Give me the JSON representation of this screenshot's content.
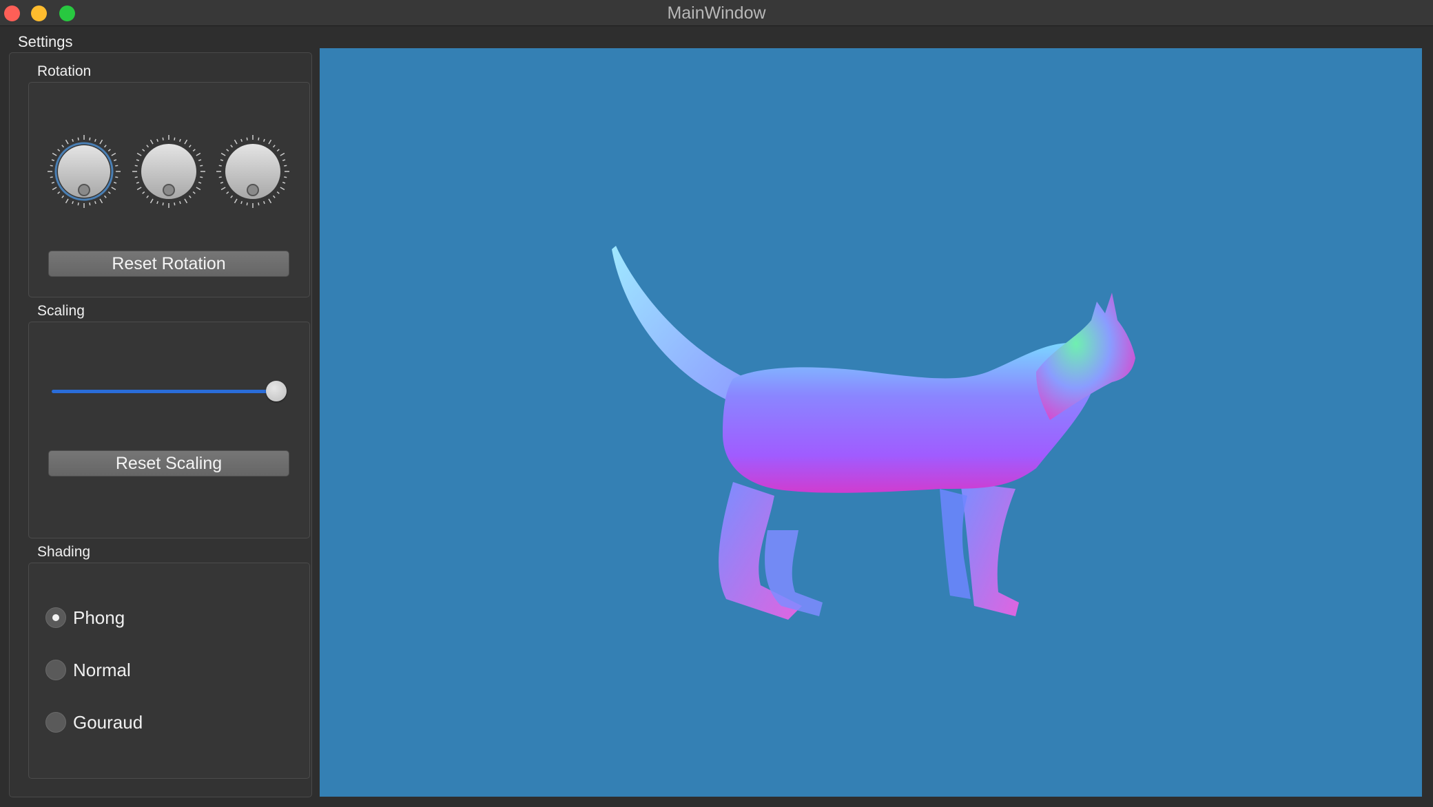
{
  "window": {
    "title": "MainWindow"
  },
  "menu": {
    "settings_label": "Settings"
  },
  "rotation": {
    "label": "Rotation",
    "dials": [
      {
        "name": "x-rotation-dial",
        "value": 0,
        "focused": true
      },
      {
        "name": "y-rotation-dial",
        "value": 0,
        "focused": false
      },
      {
        "name": "z-rotation-dial",
        "value": 0,
        "focused": false
      }
    ],
    "reset_label": "Reset Rotation"
  },
  "scaling": {
    "label": "Scaling",
    "slider_fraction": 1.0,
    "reset_label": "Reset Scaling"
  },
  "shading": {
    "label": "Shading",
    "options": [
      {
        "label": "Phong",
        "checked": true
      },
      {
        "label": "Normal",
        "checked": false
      },
      {
        "label": "Gouraud",
        "checked": false
      }
    ]
  },
  "viewport": {
    "background": "#3480b4",
    "model": "cat-mesh-normal-shaded"
  },
  "colors": {
    "accent": "#2a6dd9",
    "close": "#fe5f57",
    "minimize": "#febc2e",
    "maximize": "#28c840"
  }
}
